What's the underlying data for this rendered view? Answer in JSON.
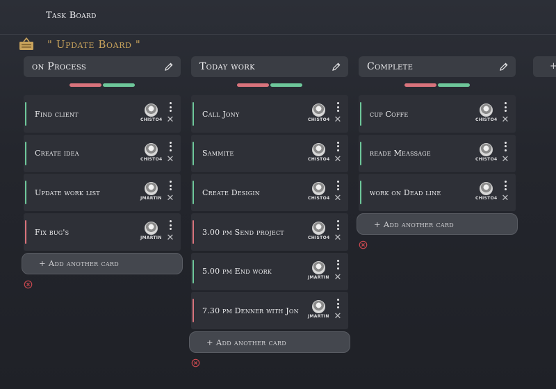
{
  "app": {
    "title": "Task Board"
  },
  "board": {
    "title": "\" Update Board \""
  },
  "add_card_label": "+ Add another card",
  "ghost_column_label": "+",
  "columns": [
    {
      "title": "on Process",
      "cards": [
        {
          "text": "Find client",
          "user": "CHISTO4",
          "color": "green"
        },
        {
          "text": "Create idea",
          "user": "CHISTO4",
          "color": "green"
        },
        {
          "text": "Update work list",
          "user": "JMARTIN",
          "color": "green"
        },
        {
          "text": "Fix bug's",
          "user": "JMARTIN",
          "color": "red"
        }
      ]
    },
    {
      "title": "Today work",
      "cards": [
        {
          "text": "Call Jony",
          "user": "CHISTO4",
          "color": "green"
        },
        {
          "text": "Sammite",
          "user": "CHISTO4",
          "color": "green"
        },
        {
          "text": "Create Desigin",
          "user": "CHISTO4",
          "color": "green"
        },
        {
          "text": "3.00 pm Send project",
          "user": "CHISTO4",
          "color": "red"
        },
        {
          "text": "5.00 pm End work",
          "user": "JMARTIN",
          "color": "green"
        },
        {
          "text": "7.30 pm Denner with Jon",
          "user": "JMARTIN",
          "color": "red"
        }
      ]
    },
    {
      "title": "Complete",
      "cards": [
        {
          "text": "cup Coffe",
          "user": "CHISTO4",
          "color": "green"
        },
        {
          "text": "reade Meassage",
          "user": "CHISTO4",
          "color": "green"
        },
        {
          "text": "work on Dead line",
          "user": "CHISTO4",
          "color": "green"
        }
      ]
    }
  ],
  "colors": {
    "accent_gold": "#c9a35c",
    "label_red": "#d9737c",
    "label_green": "#6ec79a",
    "remove_red": "#c8484f"
  },
  "icons": {
    "board": "hanging-sign-icon",
    "edit": "pencil-icon",
    "card_menu": "kebab-menu-icon",
    "card_close": "close-icon",
    "remove_column": "remove-circle-icon"
  }
}
